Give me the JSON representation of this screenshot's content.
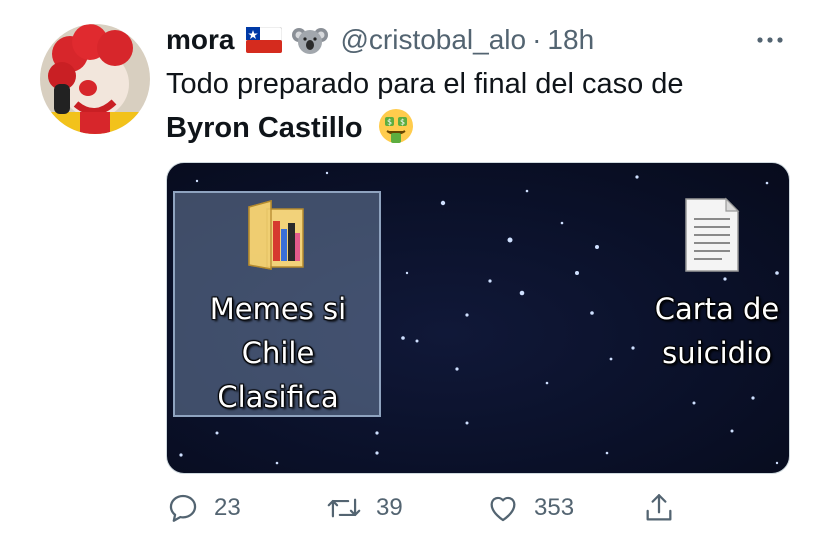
{
  "tweet": {
    "display_name": "mora",
    "flag_icon": "chile-flag-icon",
    "emoji_icon": "koala-icon",
    "handle": "@cristobal_alo",
    "separator": "·",
    "time": "18h",
    "text_line1": "Todo preparado para el final del caso de",
    "text_bold": "Byron Castillo",
    "text_emoji": "money-mouth-face-icon",
    "more_icon": "more-options-icon"
  },
  "media": {
    "folder": {
      "label_lines": [
        "Memes si",
        "Chile",
        "Clasifica"
      ],
      "icon": "folder-icon"
    },
    "file": {
      "label_lines": [
        "Carta de",
        "suicidio"
      ],
      "icon": "text-file-icon"
    }
  },
  "actions": {
    "reply": {
      "icon": "reply-icon",
      "count": "23"
    },
    "retweet": {
      "icon": "retweet-icon",
      "count": "39"
    },
    "like": {
      "icon": "heart-icon",
      "count": "353"
    },
    "share": {
      "icon": "share-icon"
    }
  },
  "colors": {
    "secondary_text": "#536471",
    "primary_text": "#0f1419",
    "desktop_bg": "#0a1028",
    "selection": "#8fa3bf"
  }
}
